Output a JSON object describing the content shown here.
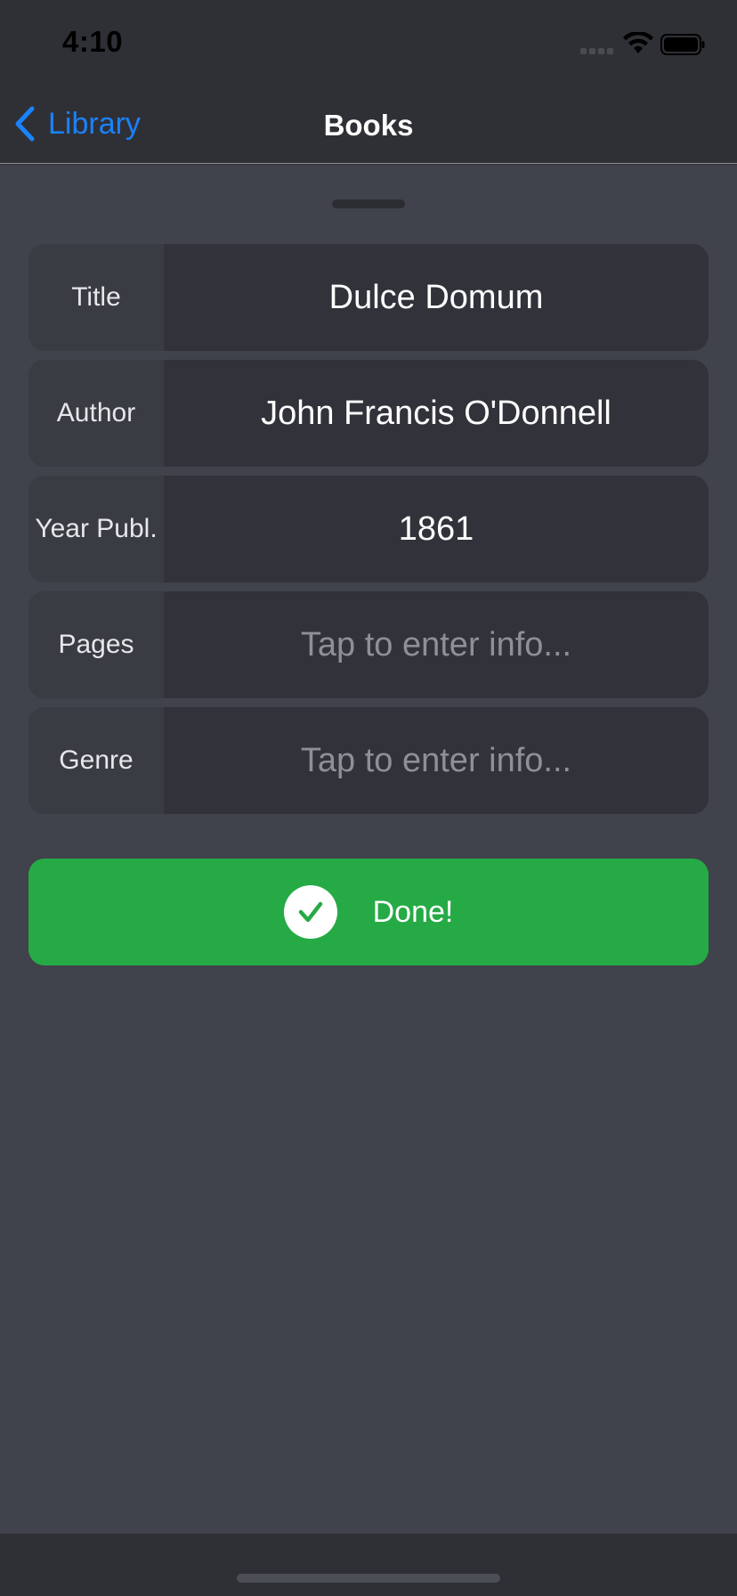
{
  "status_bar": {
    "time": "4:10"
  },
  "nav": {
    "back_label": "Library",
    "title": "Books"
  },
  "form": {
    "fields": [
      {
        "label": "Title",
        "value": "Dulce Domum",
        "placeholder": ""
      },
      {
        "label": "Author",
        "value": "John Francis O'Donnell",
        "placeholder": ""
      },
      {
        "label": "Year Publ.",
        "value": "1861",
        "placeholder": ""
      },
      {
        "label": "Pages",
        "value": "",
        "placeholder": "Tap to enter info..."
      },
      {
        "label": "Genre",
        "value": "",
        "placeholder": "Tap to enter info..."
      }
    ]
  },
  "done_button": {
    "label": "Done!"
  },
  "colors": {
    "accent": "#1a82fb",
    "done_green": "#26aa45",
    "sheet_bg": "#40434c"
  },
  "icons": {
    "back": "chevron-left-icon",
    "done": "checkmark-circle-icon",
    "wifi": "wifi-icon",
    "battery": "battery-icon"
  }
}
